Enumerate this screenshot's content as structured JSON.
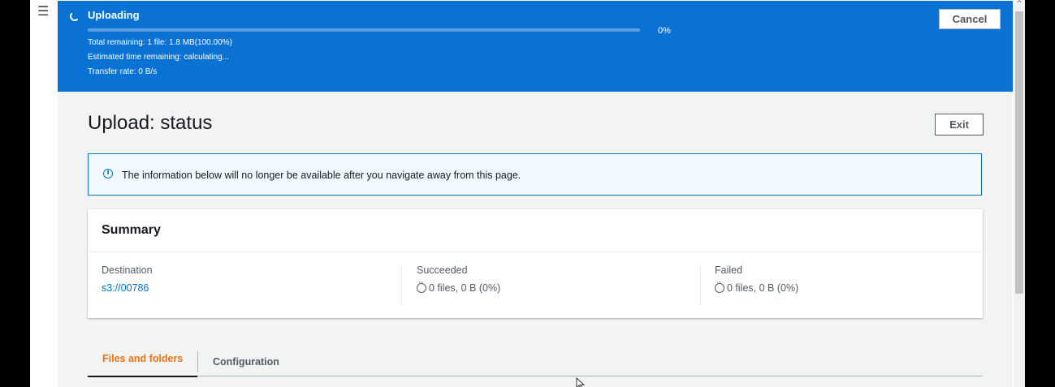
{
  "upload_banner": {
    "title": "Uploading",
    "progress_percent": 0,
    "percent_label": "0%",
    "total_remaining": "Total remaining: 1 file: 1.8 MB(100.00%)",
    "estimated_time": "Estimated time remaining: calculating...",
    "transfer_rate": "Transfer rate: 0 B/s",
    "cancel_label": "Cancel",
    "color": "#0972d3"
  },
  "page": {
    "title": "Upload: status",
    "exit_label": "Exit",
    "info_message": "The information below will no longer be available after you navigate away from this page."
  },
  "summary": {
    "heading": "Summary",
    "destination_label": "Destination",
    "destination_value": "s3://00786",
    "succeeded_label": "Succeeded",
    "succeeded_value": "0 files, 0 B (0%)",
    "failed_label": "Failed",
    "failed_value": "0 files, 0 B (0%)"
  },
  "tabs": [
    {
      "label": "Files and folders",
      "active": true
    },
    {
      "label": "Configuration",
      "active": false
    }
  ],
  "icons": {
    "menu": "hamburger-menu-icon",
    "spinner": "spinner-icon",
    "info": "info-icon",
    "pending": "pending-icon",
    "cursor": "mouse-pointer-icon"
  },
  "colors": {
    "accent": "#0073bb",
    "active_tab": "#ec7211"
  }
}
